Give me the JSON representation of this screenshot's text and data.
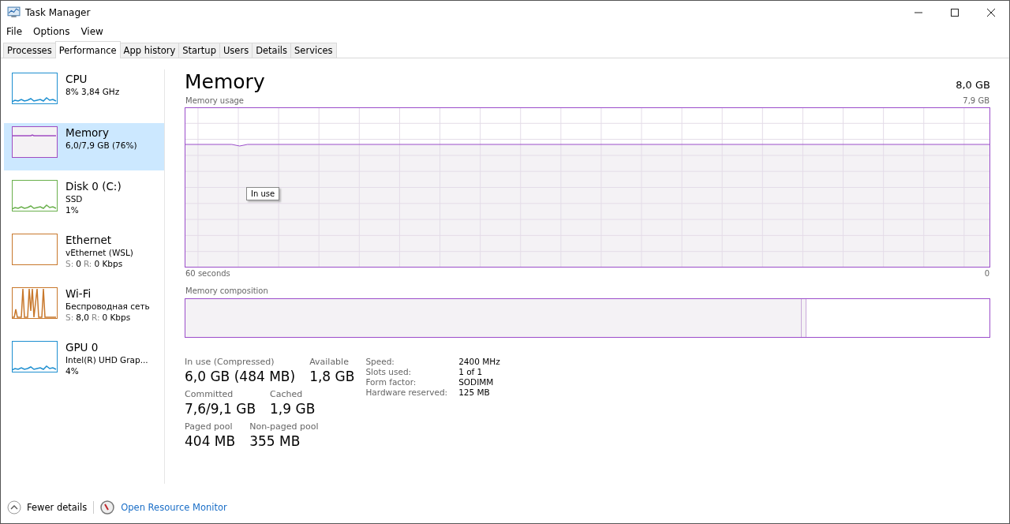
{
  "window": {
    "title": "Task Manager"
  },
  "menu": [
    "File",
    "Options",
    "View"
  ],
  "tabs": [
    {
      "label": "Processes",
      "selected": false
    },
    {
      "label": "Performance",
      "selected": true
    },
    {
      "label": "App history",
      "selected": false
    },
    {
      "label": "Startup",
      "selected": false
    },
    {
      "label": "Users",
      "selected": false
    },
    {
      "label": "Details",
      "selected": false
    },
    {
      "label": "Services",
      "selected": false
    }
  ],
  "sidebar": {
    "items": [
      {
        "name": "CPU",
        "lines": [
          "8% 3,84 GHz"
        ],
        "selected": false,
        "color": "#1e8fd0",
        "kind": "spiky"
      },
      {
        "name": "Memory",
        "lines": [
          "6,0/7,9 GB (76%)"
        ],
        "selected": true,
        "color": "#a04cc2",
        "kind": "flat"
      },
      {
        "name": "Disk 0 (C:)",
        "lines": [
          "SSD",
          "1%"
        ],
        "selected": false,
        "color": "#6ab04c",
        "kind": "spiky"
      },
      {
        "name": "Ethernet",
        "lines": [
          "vEthernet (WSL)"
        ],
        "io": {
          "send_label": "S:",
          "send": "0",
          "recv_label": "R:",
          "recv": "0 Kbps"
        },
        "selected": false,
        "color": "#c8782c",
        "kind": "empty"
      },
      {
        "name": "Wi-Fi",
        "lines": [
          "Беспроводная сеть"
        ],
        "io": {
          "send_label": "S:",
          "send": "8,0",
          "recv_label": "R:",
          "recv": "0 Kbps"
        },
        "selected": false,
        "color": "#c8782c",
        "kind": "peaks"
      },
      {
        "name": "GPU 0",
        "lines": [
          "Intel(R) UHD Grap...",
          "4%"
        ],
        "selected": false,
        "color": "#1e8fd0",
        "kind": "spiky"
      }
    ]
  },
  "main": {
    "title": "Memory",
    "total": "8,0 GB",
    "usage_label": "Memory usage",
    "usage_max": "7,9 GB",
    "tooltip": "In use",
    "x_start": "60 seconds",
    "x_end": "0",
    "composition_label": "Memory composition",
    "composition": {
      "level": 0.765
    },
    "stats": [
      {
        "label": "In use (Compressed)",
        "value": "6,0 GB (484 MB)"
      },
      {
        "label": "Available",
        "value": "1,8 GB"
      },
      {
        "label": "Committed",
        "value": "7,6/9,1 GB"
      },
      {
        "label": "Cached",
        "value": "1,9 GB"
      },
      {
        "label": "Paged pool",
        "value": "404 MB"
      },
      {
        "label": "Non-paged pool",
        "value": "355 MB"
      }
    ],
    "details": [
      {
        "label": "Speed:",
        "value": "2400 MHz"
      },
      {
        "label": "Slots used:",
        "value": "1 of 1"
      },
      {
        "label": "Form factor:",
        "value": "SODIMM"
      },
      {
        "label": "Hardware reserved:",
        "value": "125 MB"
      }
    ]
  },
  "footer": {
    "fewer": "Fewer details",
    "monitor": "Open Resource Monitor"
  }
}
